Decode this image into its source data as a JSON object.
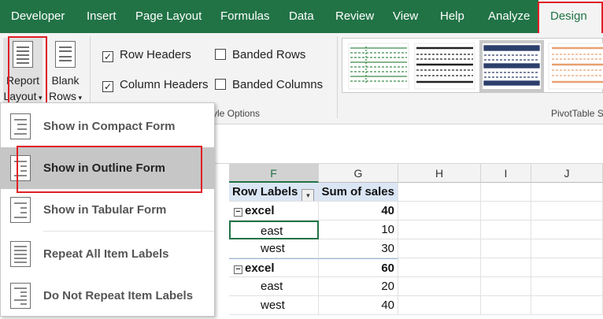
{
  "ribbon": {
    "tabs": [
      {
        "label": "Developer"
      },
      {
        "label": "Insert"
      },
      {
        "label": "Page Layout"
      },
      {
        "label": "Formulas"
      },
      {
        "label": "Data"
      },
      {
        "label": "Review"
      },
      {
        "label": "View"
      },
      {
        "label": "Help"
      },
      {
        "label": "Analyze"
      },
      {
        "label": "Design"
      }
    ],
    "report_layout": {
      "line1": "Report",
      "line2": "Layout"
    },
    "blank_rows": {
      "line1": "Blank",
      "line2": "Rows"
    },
    "options": {
      "row_headers": "Row Headers",
      "column_headers": "Column Headers",
      "banded_rows": "Banded Rows",
      "banded_columns": "Banded Columns"
    },
    "group_style_options": "yle Options",
    "group_pivot_styles": "PivotTable S"
  },
  "menu": {
    "items": [
      {
        "label": "Show in Compact Form",
        "icon": "compact-form-icon"
      },
      {
        "label": "Show in Outline Form",
        "icon": "outline-form-icon"
      },
      {
        "label": "Show in Tabular Form",
        "icon": "tabular-form-icon"
      },
      {
        "label": "Repeat All Item Labels",
        "icon": "repeat-labels-icon"
      },
      {
        "label": "Do Not Repeat Item Labels",
        "icon": "no-repeat-labels-icon"
      }
    ]
  },
  "grid": {
    "columns": [
      "F",
      "G",
      "H",
      "I",
      "J"
    ],
    "header_row": {
      "row_labels": "Row Labels",
      "sum_of_sales": "Sum of sales"
    },
    "rows": [
      {
        "label": "excel",
        "value": "40",
        "group": true
      },
      {
        "label": "east",
        "value": "10",
        "group": false
      },
      {
        "label": "west",
        "value": "30",
        "group": false
      },
      {
        "label": "excel",
        "value": "60",
        "group": true
      },
      {
        "label": "east",
        "value": "20",
        "group": false
      },
      {
        "label": "west",
        "value": "40",
        "group": false
      }
    ]
  },
  "colors": {
    "ribbon_green": "#217346",
    "highlight_red": "#e01e26",
    "pivot_header_blue": "#dbe6f5"
  }
}
